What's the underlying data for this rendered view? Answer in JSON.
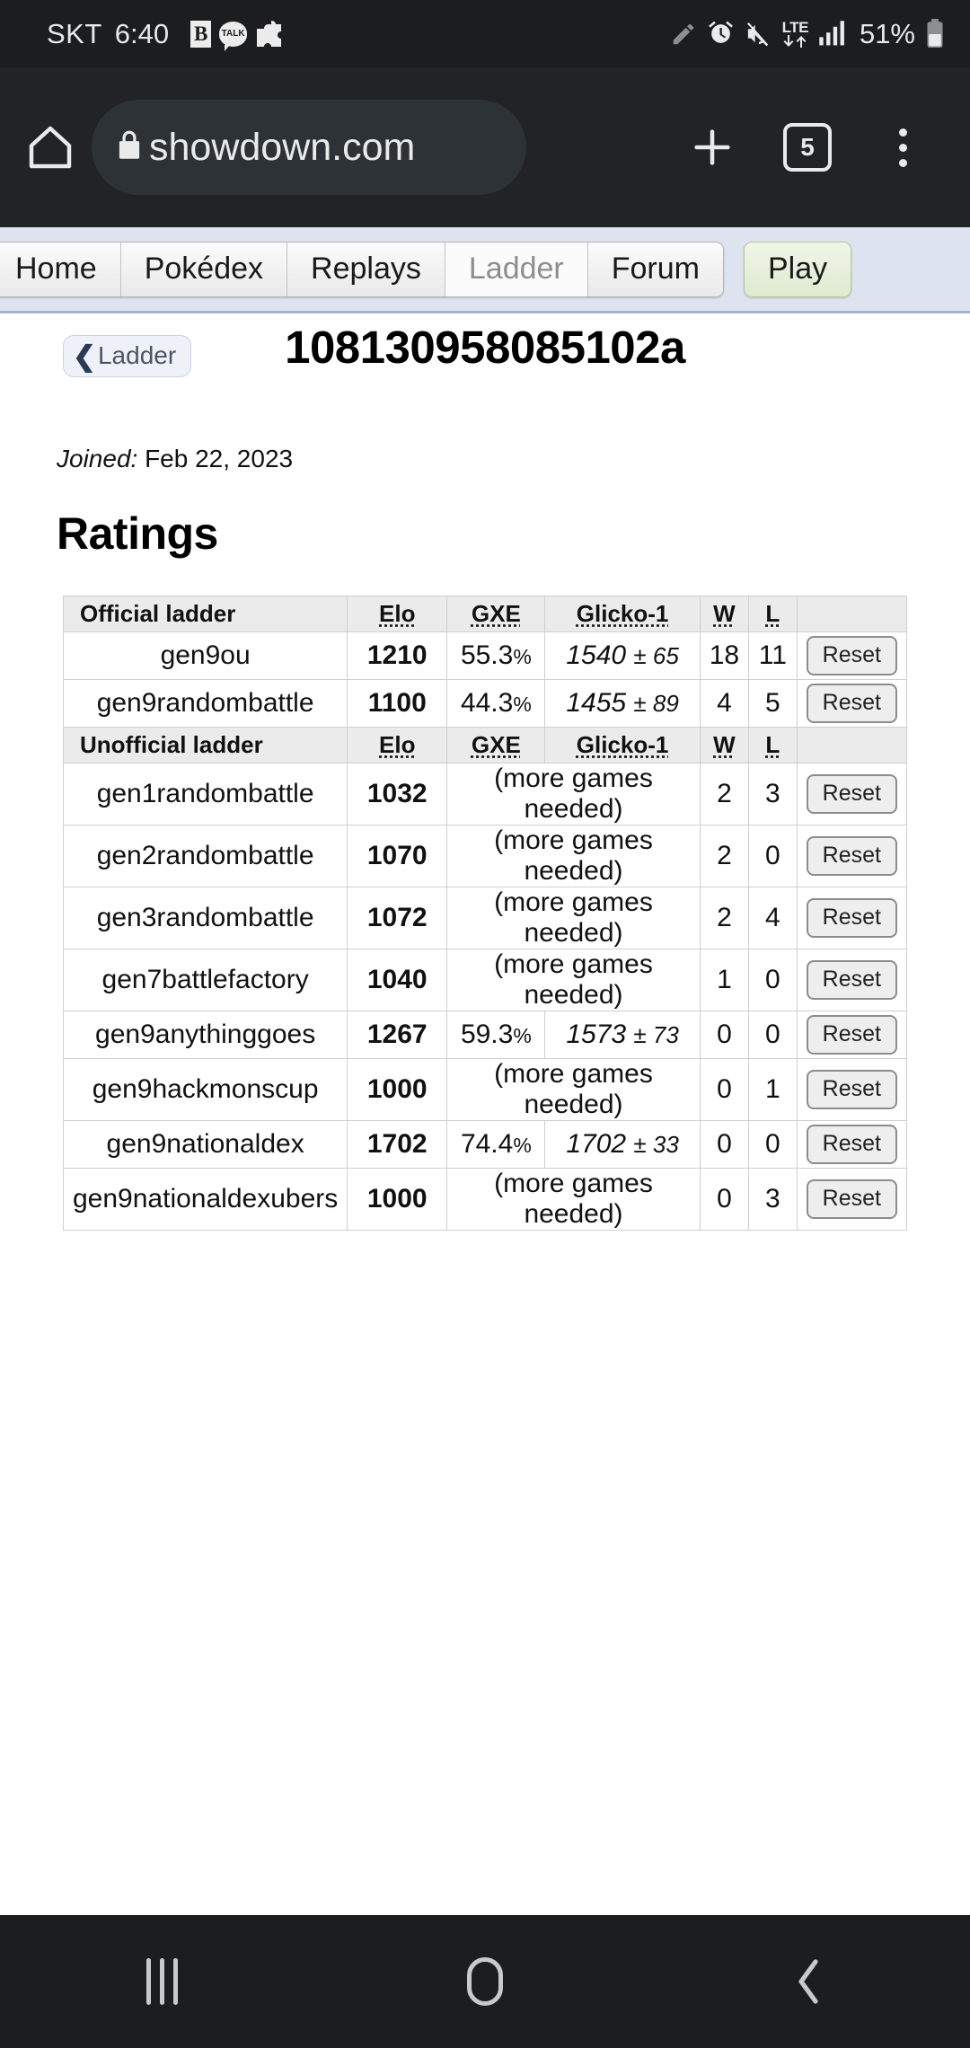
{
  "status_bar": {
    "carrier": "SKT",
    "clock": "6:40",
    "notification_icons": [
      "b-app-icon",
      "kakaotalk-icon",
      "puzzle-piece-icon"
    ],
    "talk_label": "TALK",
    "b_label": "B",
    "right_icons": [
      "pencil-icon",
      "alarm-icon",
      "mute-icon",
      "lte-data-icon",
      "signal-bars-icon"
    ],
    "network_type": "LTE",
    "battery_percent": "51%"
  },
  "browser": {
    "home_icon": "home-icon",
    "lock_icon": "lock-icon",
    "url": "showdown.com",
    "new_tab_icon": "plus-icon",
    "tab_count": "5",
    "menu_icon": "kebab-menu-icon"
  },
  "site_nav": {
    "tabs": [
      {
        "label": "Home",
        "current": false
      },
      {
        "label": "Pokédex",
        "current": false
      },
      {
        "label": "Replays",
        "current": false
      },
      {
        "label": "Ladder",
        "current": true
      },
      {
        "label": "Forum",
        "current": false
      }
    ],
    "play_label": "Play"
  },
  "header": {
    "back_label": "Ladder",
    "back_chevron": "chevron-left-icon",
    "username": "108130958085102a",
    "joined_label": "Joined:",
    "joined_date": "Feb 22, 2023",
    "section_title": "Ratings"
  },
  "table": {
    "columns": [
      "ladder",
      "Elo",
      "GXE",
      "Glicko-1",
      "W",
      "L",
      ""
    ],
    "official_header": "Official ladder",
    "unofficial_header": "Unofficial ladder",
    "col_elo": "Elo",
    "col_gxe": "GXE",
    "col_glicko": "Glicko-1",
    "col_w": "W",
    "col_l": "L",
    "reset_label": "Reset",
    "more_games_text": "(more games needed)",
    "official_rows": [
      {
        "format": "gen9ou",
        "elo": "1210",
        "gxe": "55.3",
        "gxe_unit": "%",
        "glicko": "1540",
        "dev": "± 65",
        "w": "18",
        "l": "11",
        "reset": "Reset"
      },
      {
        "format": "gen9randombattle",
        "elo": "1100",
        "gxe": "44.3",
        "gxe_unit": "%",
        "glicko": "1455",
        "dev": "± 89",
        "w": "4",
        "l": "5",
        "reset": "Reset"
      }
    ],
    "unofficial_rows": [
      {
        "format": "gen1randombattle",
        "elo": "1032",
        "gxe": null,
        "gxe_unit": "",
        "glicko": null,
        "dev": "",
        "w": "2",
        "l": "3",
        "reset": "Reset"
      },
      {
        "format": "gen2randombattle",
        "elo": "1070",
        "gxe": null,
        "gxe_unit": "",
        "glicko": null,
        "dev": "",
        "w": "2",
        "l": "0",
        "reset": "Reset"
      },
      {
        "format": "gen3randombattle",
        "elo": "1072",
        "gxe": null,
        "gxe_unit": "",
        "glicko": null,
        "dev": "",
        "w": "2",
        "l": "4",
        "reset": "Reset"
      },
      {
        "format": "gen7battlefactory",
        "elo": "1040",
        "gxe": null,
        "gxe_unit": "",
        "glicko": null,
        "dev": "",
        "w": "1",
        "l": "0",
        "reset": "Reset"
      },
      {
        "format": "gen9anythinggoes",
        "elo": "1267",
        "gxe": "59.3",
        "gxe_unit": "%",
        "glicko": "1573",
        "dev": "± 73",
        "w": "0",
        "l": "0",
        "reset": "Reset"
      },
      {
        "format": "gen9hackmonscup",
        "elo": "1000",
        "gxe": null,
        "gxe_unit": "",
        "glicko": null,
        "dev": "",
        "w": "0",
        "l": "1",
        "reset": "Reset"
      },
      {
        "format": "gen9nationaldex",
        "elo": "1702",
        "gxe": "74.4",
        "gxe_unit": "%",
        "glicko": "1702",
        "dev": "± 33",
        "w": "0",
        "l": "0",
        "reset": "Reset"
      },
      {
        "format": "gen9nationaldexubers",
        "elo": "1000",
        "gxe": null,
        "gxe_unit": "",
        "glicko": null,
        "dev": "",
        "w": "0",
        "l": "3",
        "reset": "Reset"
      }
    ]
  },
  "android_nav": {
    "recents_icon": "recents-icon",
    "home_icon": "home-icon",
    "back_icon": "back-icon"
  },
  "colors": {
    "chrome_bg": "#222326",
    "statusbar_bg": "#1c1d1f",
    "nav_bg": "#dee3f0",
    "play_green": "#dfead0",
    "muted_text": "#9a9a9a"
  }
}
